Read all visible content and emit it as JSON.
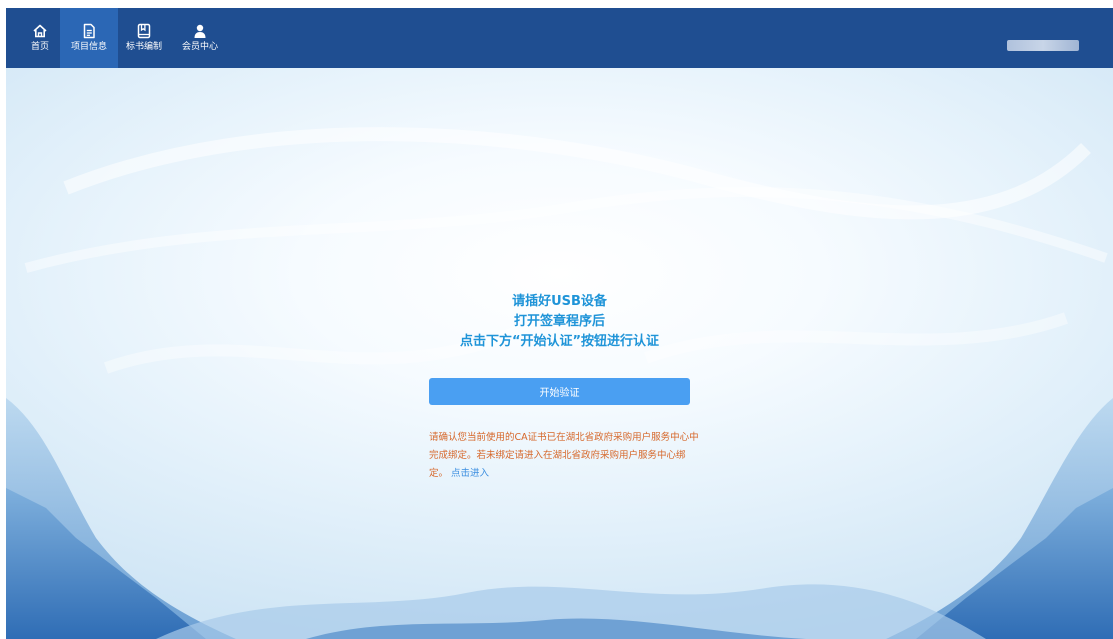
{
  "nav": {
    "items": [
      {
        "label": "首页",
        "icon": "home-icon"
      },
      {
        "label": "项目信息",
        "icon": "document-icon",
        "active": true
      },
      {
        "label": "标书编制",
        "icon": "book-icon"
      },
      {
        "label": "会员中心",
        "icon": "user-icon"
      }
    ]
  },
  "main": {
    "line1": "请插好USB设备",
    "line2": "打开签章程序后",
    "line3": "点击下方“开始认证”按钮进行认证",
    "start_button": "开始验证",
    "notice_text": "请确认您当前使用的CA证书已在湖北省政府采购用户服务中心中完成绑定。若未绑定请进入在湖北省政府采购用户服务中心绑定。",
    "notice_link": "点击进入"
  },
  "colors": {
    "topbar": "#1f4e91",
    "active_tab": "#2b67b5",
    "headline": "#1f94d8",
    "button": "#4a9ff2",
    "notice": "#d6672a",
    "link": "#3b8ee0"
  }
}
